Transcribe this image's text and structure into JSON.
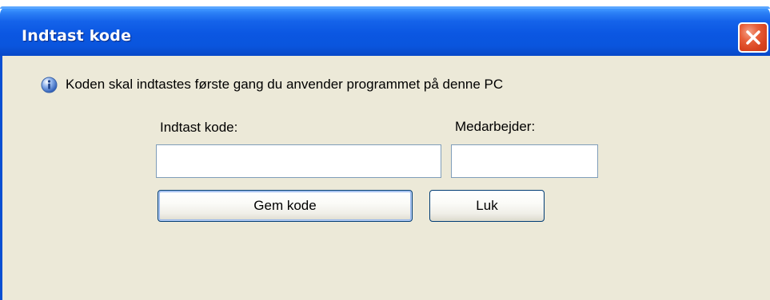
{
  "window": {
    "title": "Indtast kode",
    "colors": {
      "titlebar": "#0a55dd",
      "client": "#ece9d8",
      "close": "#d8431f"
    }
  },
  "info": {
    "icon": "info-icon",
    "message": "Koden skal indtastes første gang du anvender programmet på denne PC"
  },
  "form": {
    "code_label": "Indtast kode:",
    "code_value": "",
    "employee_label": "Medarbejder:",
    "employee_value": ""
  },
  "buttons": {
    "save_label": "Gem kode",
    "close_label": "Luk"
  }
}
